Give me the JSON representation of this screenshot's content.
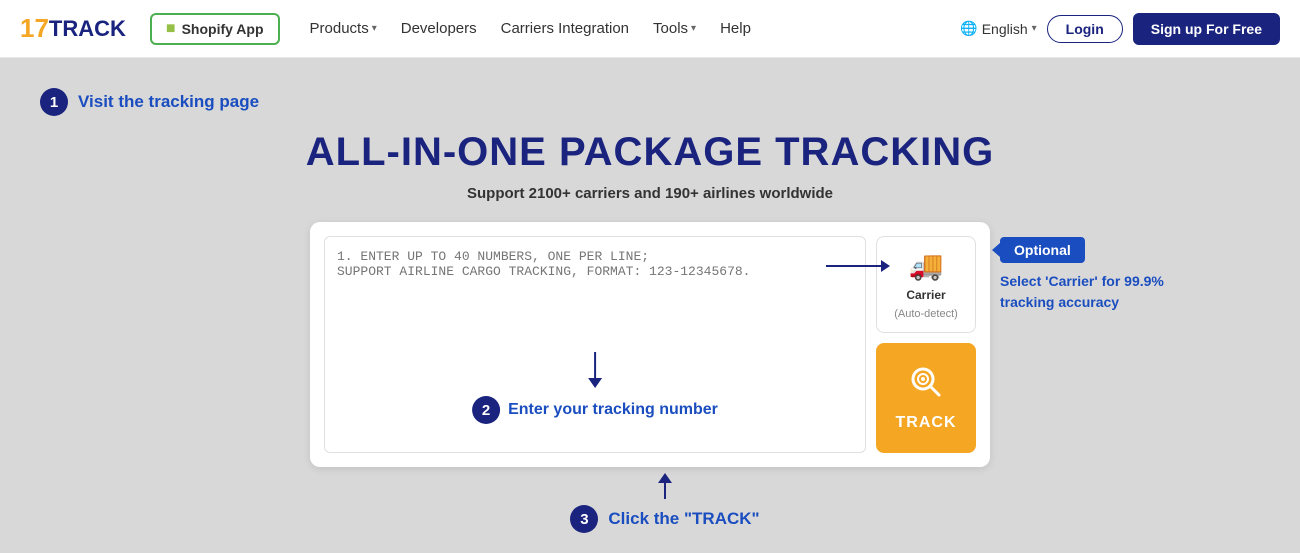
{
  "header": {
    "logo_17": "17",
    "logo_track": "TRACK",
    "shopify_label": "Shopify App",
    "nav": {
      "products_label": "Products",
      "developers_label": "Developers",
      "carriers_integration_label": "Carriers Integration",
      "tools_label": "Tools",
      "help_label": "Help",
      "language_label": "English"
    },
    "login_label": "Login",
    "signup_label": "Sign up For Free"
  },
  "main": {
    "step1_badge": "1",
    "step1_text": "Visit the tracking page",
    "page_title": "ALL-IN-ONE PACKAGE TRACKING",
    "subtitle": "Support 2100+ carriers and 190+ airlines worldwide",
    "textarea_placeholder_line1": "1. ENTER UP TO 40 NUMBERS, ONE PER LINE;",
    "textarea_placeholder_line2": "SUPPORT AIRLINE CARGO TRACKING, FORMAT: 123-12345678.",
    "step2_badge": "2",
    "step2_text": "Enter your tracking number",
    "carrier_label": "Carrier",
    "carrier_sub": "(Auto-detect)",
    "track_label": "TRACK",
    "optional_label": "Optional",
    "optional_desc": "Select 'Carrier' for 99.9% tracking accuracy",
    "step3_badge": "3",
    "step3_text": "Click the \"TRACK\""
  }
}
